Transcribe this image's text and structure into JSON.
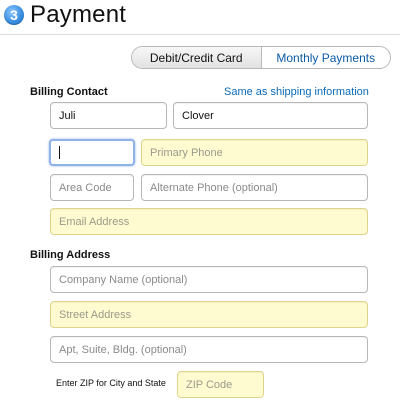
{
  "header": {
    "step_number": "3",
    "title": "Payment"
  },
  "payment_tabs": [
    {
      "label": "Debit/Credit Card",
      "active": true
    },
    {
      "label": "Monthly Payments",
      "active": false
    }
  ],
  "billing_contact": {
    "section_label": "Billing Contact",
    "same_as_shipping_link": "Same as shipping information",
    "first_name": {
      "value": "Juli"
    },
    "last_name": {
      "value": "Clover"
    },
    "primary_area_code": {
      "value": ""
    },
    "primary_phone": {
      "placeholder": "Primary Phone"
    },
    "alt_area_code": {
      "placeholder": "Area Code"
    },
    "alt_phone": {
      "placeholder": "Alternate Phone (optional)"
    },
    "email": {
      "placeholder": "Email Address"
    }
  },
  "billing_address": {
    "section_label": "Billing Address",
    "company": {
      "placeholder": "Company Name (optional)"
    },
    "street": {
      "placeholder": "Street Address"
    },
    "apt": {
      "placeholder": "Apt, Suite, Bldg. (optional)"
    },
    "zip_label": "Enter ZIP for City and State",
    "zip": {
      "placeholder": "ZIP Code"
    }
  },
  "colors": {
    "required_field_bg": "#fffbd0",
    "link": "#0a6ab8",
    "step_badge": "#3b8fe0",
    "focus_ring": "#8fb3e6"
  }
}
